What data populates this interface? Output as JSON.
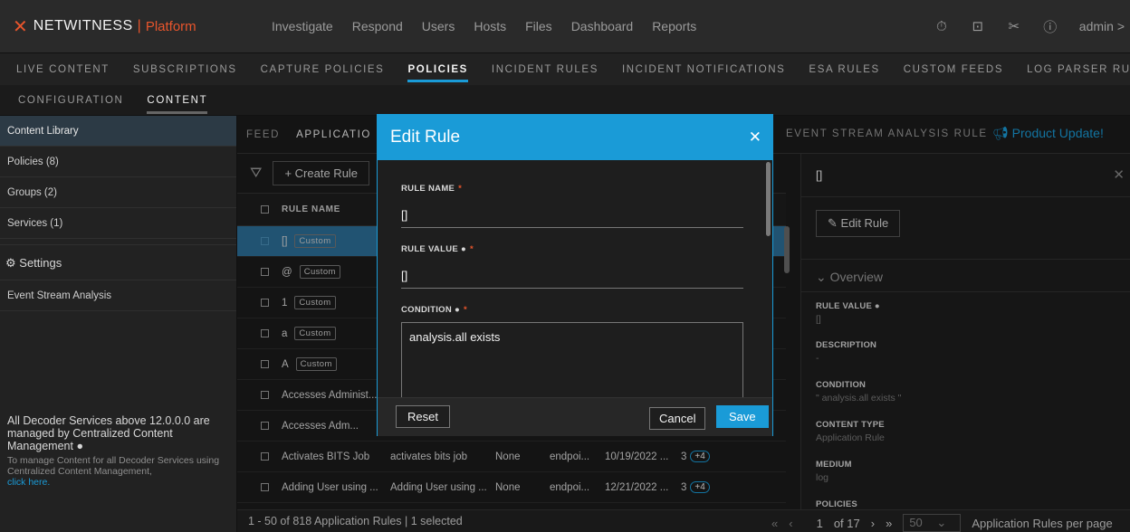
{
  "brand": {
    "name": "NETWITNESS",
    "product": "Platform"
  },
  "main_nav": [
    "Investigate",
    "Respond",
    "Users",
    "Hosts",
    "Files",
    "Dashboard",
    "Reports"
  ],
  "user": {
    "name": "admin >"
  },
  "sub_nav": [
    "LIVE CONTENT",
    "SUBSCRIPTIONS",
    "CAPTURE POLICIES",
    "POLICIES",
    "INCIDENT RULES",
    "INCIDENT NOTIFICATIONS",
    "ESA RULES",
    "CUSTOM FEEDS",
    "LOG PARSER RULES"
  ],
  "sub_nav_active": "POLICIES",
  "config_nav": [
    "CONFIGURATION",
    "CONTENT"
  ],
  "sidebar": {
    "items": [
      "Content Library",
      "Policies (8)",
      "Groups (2)",
      "Services (1)"
    ],
    "settings": "Settings",
    "esa": "Event Stream Analysis",
    "note_title": "All Decoder Services above 12.0.0.0 are managed by Centralized Content Management",
    "note_text": "To manage Content for all Decoder Services using Centralized Content Management,",
    "note_link": "click here."
  },
  "tabs": {
    "feed": "FEED",
    "application": "APPLICATIO",
    "esa": "EVENT STREAM ANALYSIS RULE",
    "product_update": "Product Update!"
  },
  "list": {
    "create_label": "Create Rule",
    "col_rule_name": "RULE NAME",
    "tag_custom": "Custom",
    "rows": [
      {
        "name": "[]",
        "tag": "Custom"
      },
      {
        "name": "@",
        "tag": "Custom"
      },
      {
        "name": "1",
        "tag": "Custom"
      },
      {
        "name": "a",
        "tag": "Custom"
      },
      {
        "name": "A",
        "tag": "Custom"
      },
      {
        "name": "Accesses Administ..."
      },
      {
        "name": "Accesses Adm..."
      },
      {
        "name": "Activates BITS Job",
        "value": "activates bits job",
        "alert": "None",
        "medium": "endpoi...",
        "date": "10/19/2022 ...",
        "count": "3",
        "more": "+4"
      },
      {
        "name": "Adding User using ...",
        "value": "Adding User using ...",
        "alert": "None",
        "medium": "endpoi...",
        "date": "12/21/2022 ...",
        "count": "3",
        "more": "+4"
      }
    ],
    "summary": "1 - 50 of 818 Application Rules | 1 selected",
    "page": "1",
    "of": "of 17",
    "per_page": "50",
    "per_page_label": "Application Rules per page"
  },
  "detail": {
    "title": "[]",
    "edit_btn": "Edit Rule",
    "overview": "Overview",
    "fields": [
      {
        "label": "RULE VALUE",
        "value": "[]"
      },
      {
        "label": "DESCRIPTION",
        "value": "-"
      },
      {
        "label": "CONDITION",
        "value": "\" analysis.all exists \""
      },
      {
        "label": "CONTENT TYPE",
        "value": "Application Rule"
      },
      {
        "label": "MEDIUM",
        "value": "log"
      },
      {
        "label": "POLICIES",
        "value": ""
      }
    ]
  },
  "modal": {
    "title": "Edit Rule",
    "rule_name_label": "RULE NAME",
    "rule_name_value": "[]",
    "rule_value_label": "RULE VALUE",
    "rule_value_value": "[]",
    "condition_label": "CONDITION",
    "condition_value": "analysis.all exists",
    "reset": "Reset",
    "cancel": "Cancel",
    "save": "Save"
  },
  "colors": {
    "accent": "#1a9bd7",
    "brand": "#e8552c",
    "selected_row": "#2d6f98"
  }
}
